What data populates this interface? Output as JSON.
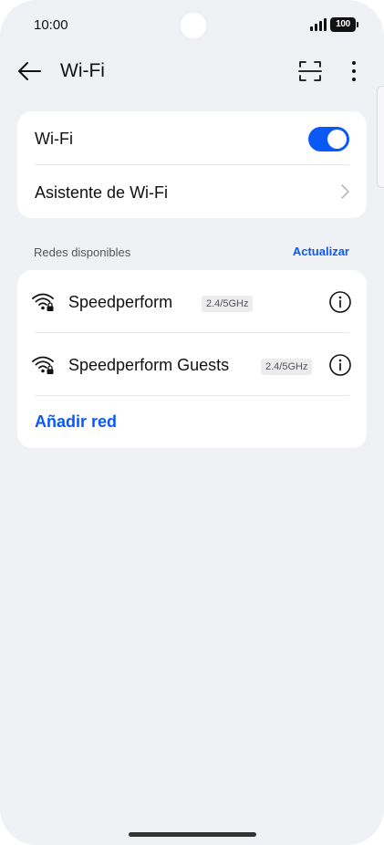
{
  "status_bar": {
    "time": "10:00",
    "battery": "100"
  },
  "header": {
    "title": "Wi-Fi",
    "back_icon": "arrow-left-icon",
    "scan_icon": "scan-qr-icon",
    "more_icon": "more-vertical-icon"
  },
  "main_card": {
    "wifi_label": "Wi-Fi",
    "wifi_enabled": true,
    "assistant_label": "Asistente de Wi-Fi"
  },
  "networks_section": {
    "header": "Redes disponibles",
    "refresh_label": "Actualizar",
    "networks": [
      {
        "name": "Speedperform",
        "band": "2.4/5GHz",
        "secured": true
      },
      {
        "name": "Speedperform Guests",
        "band": "2.4/5GHz",
        "secured": true
      }
    ],
    "add_network_label": "Añadir red"
  },
  "colors": {
    "accent": "#0a59f7",
    "background": "#f0f1f5",
    "card": "#ffffff"
  }
}
